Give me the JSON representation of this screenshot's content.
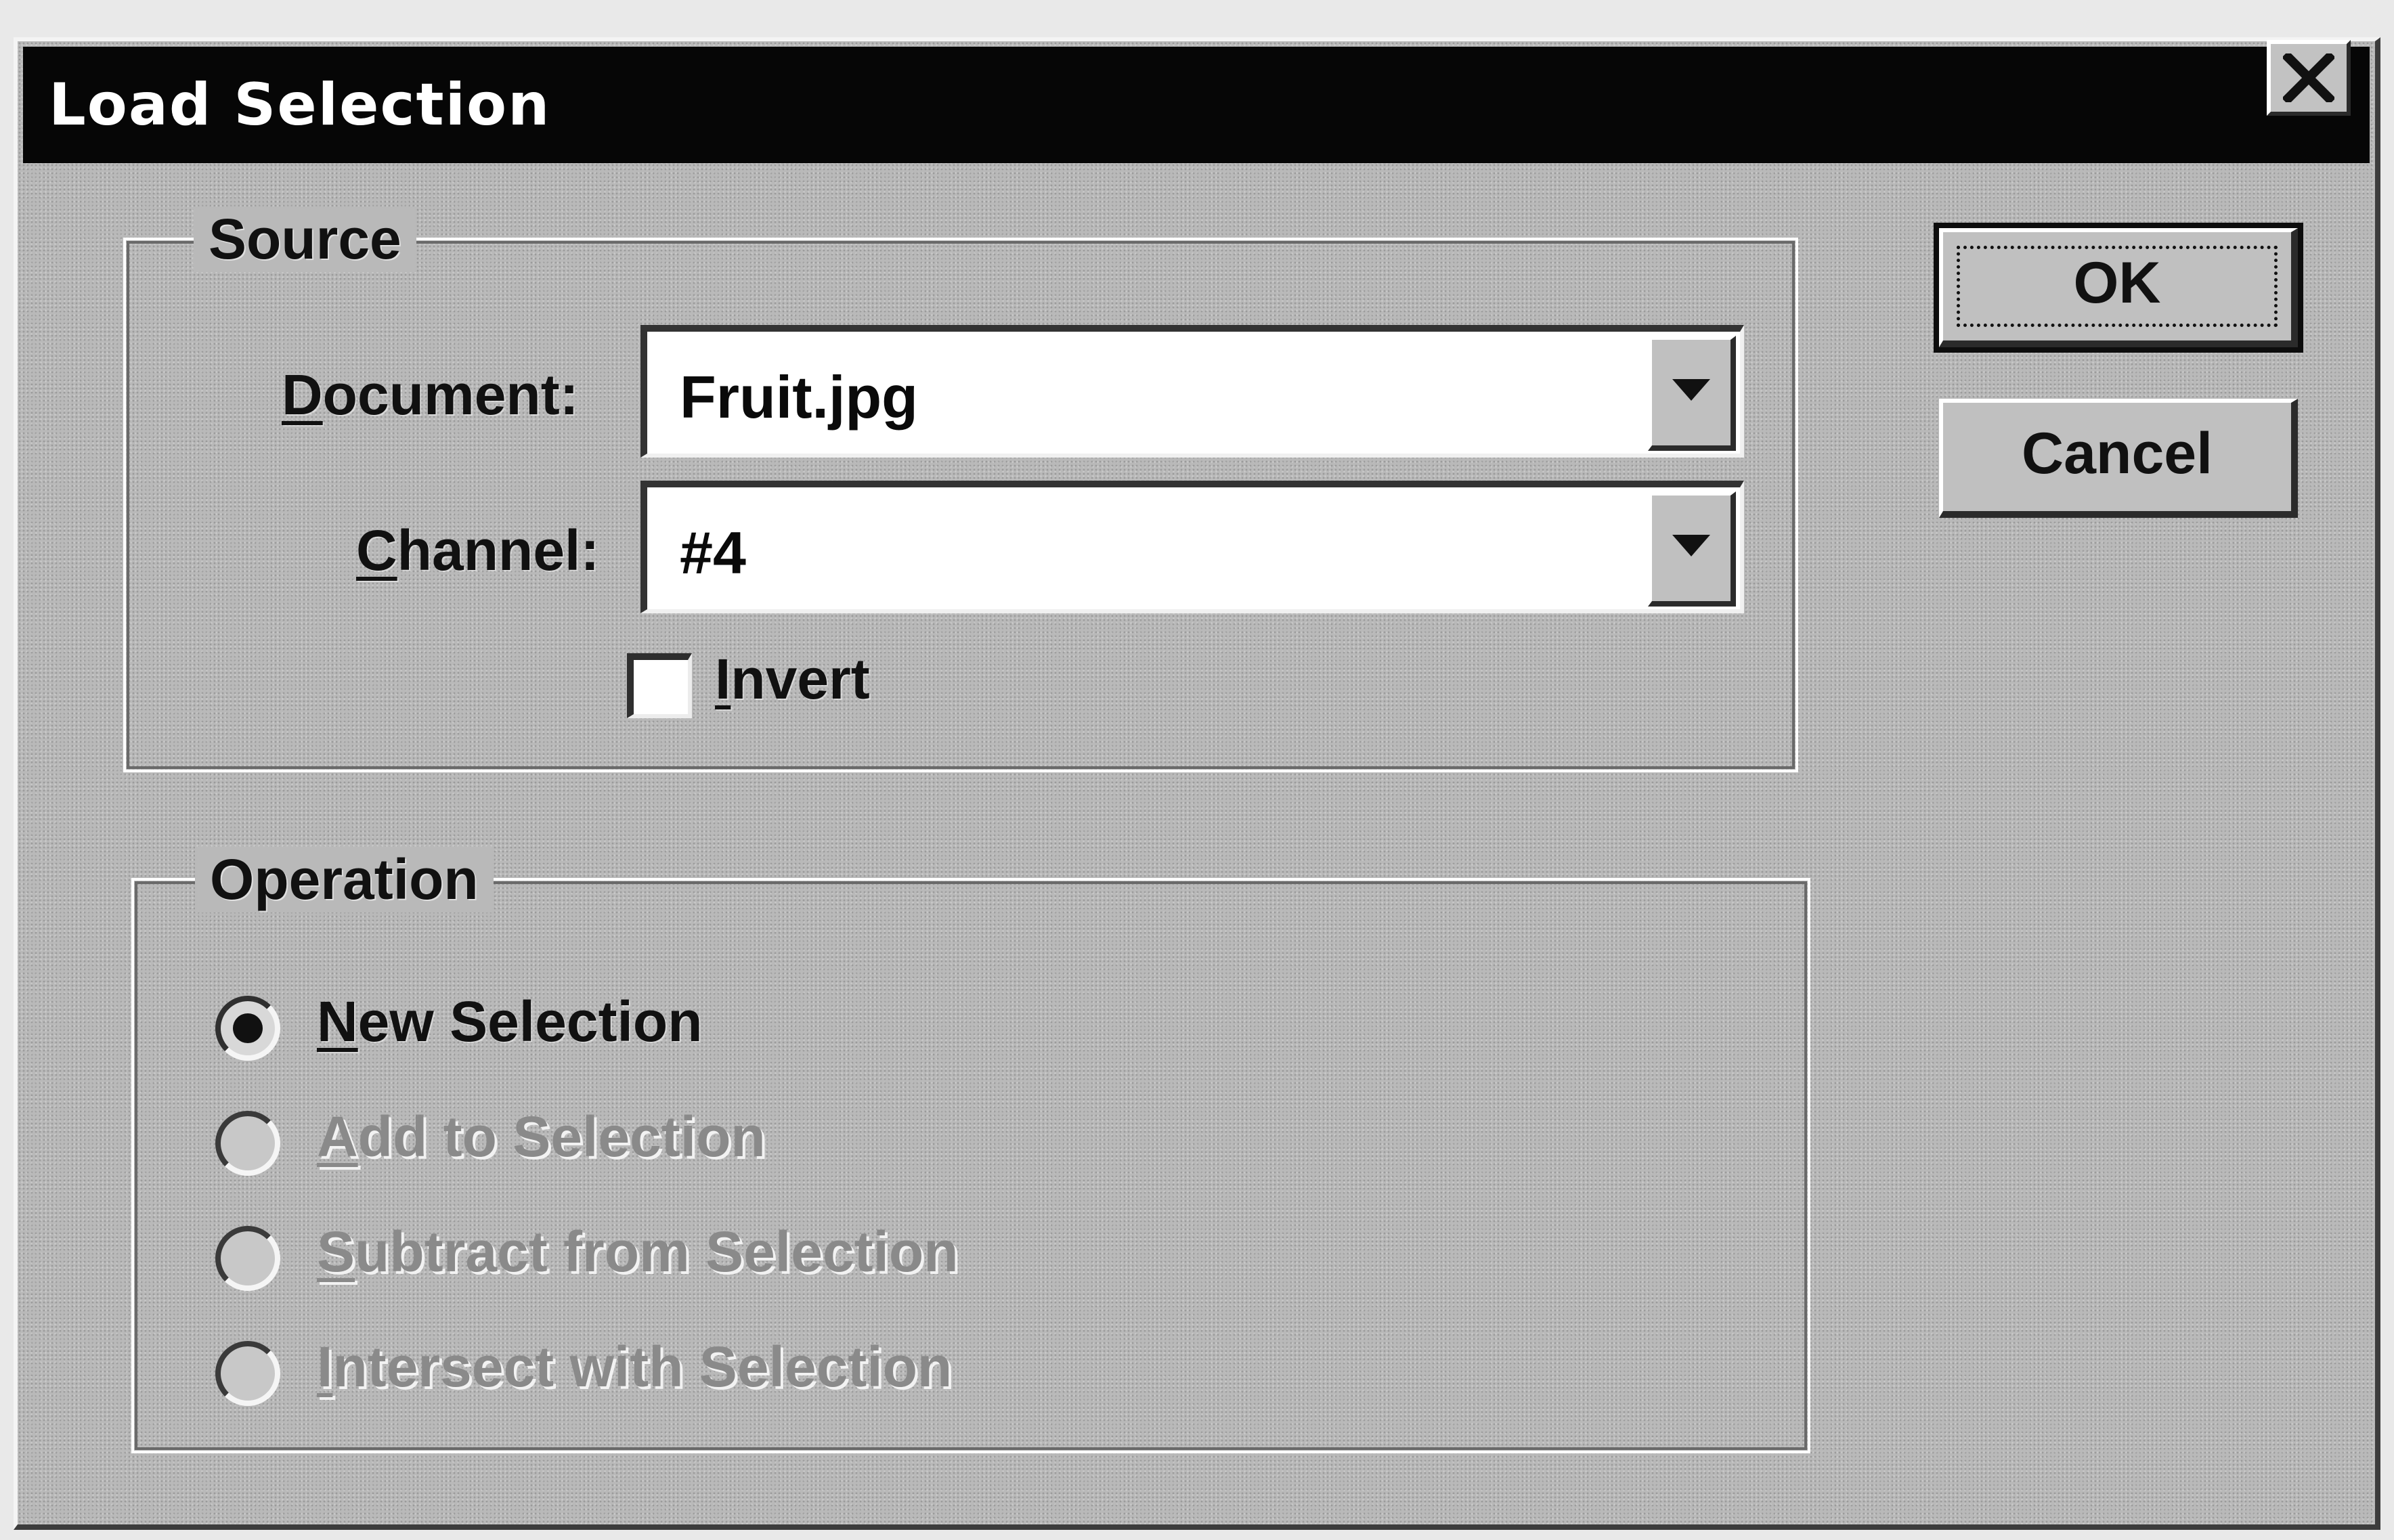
{
  "window": {
    "title": "Load Selection"
  },
  "buttons": {
    "ok": "OK",
    "cancel": "Cancel"
  },
  "source": {
    "legend": "Source",
    "document_label": "Document:",
    "document_mnemonic": "D",
    "document_rest": "ocument:",
    "document_value": "Fruit.jpg",
    "channel_label": "Channel:",
    "channel_mnemonic": "C",
    "channel_rest": "hannel:",
    "channel_value": "#4",
    "invert_mnemonic": "I",
    "invert_rest": "nvert",
    "invert_label": "Invert",
    "invert_checked": false
  },
  "operation": {
    "legend": "Operation",
    "options": [
      {
        "label": "New Selection",
        "mnemonic": "N",
        "rest": "ew Selection",
        "selected": true,
        "enabled": true
      },
      {
        "label": "Add to Selection",
        "mnemonic": "A",
        "rest": "dd to Selection",
        "selected": false,
        "enabled": false
      },
      {
        "label": "Subtract from Selection",
        "mnemonic": "S",
        "rest": "ubtract from Selection",
        "selected": false,
        "enabled": false
      },
      {
        "label": "Intersect with Selection",
        "mnemonic": "I",
        "rest": "ntersect with Selection",
        "selected": false,
        "enabled": false
      }
    ]
  },
  "icons": {
    "close": "close-icon",
    "dropdown": "chevron-down-icon"
  }
}
